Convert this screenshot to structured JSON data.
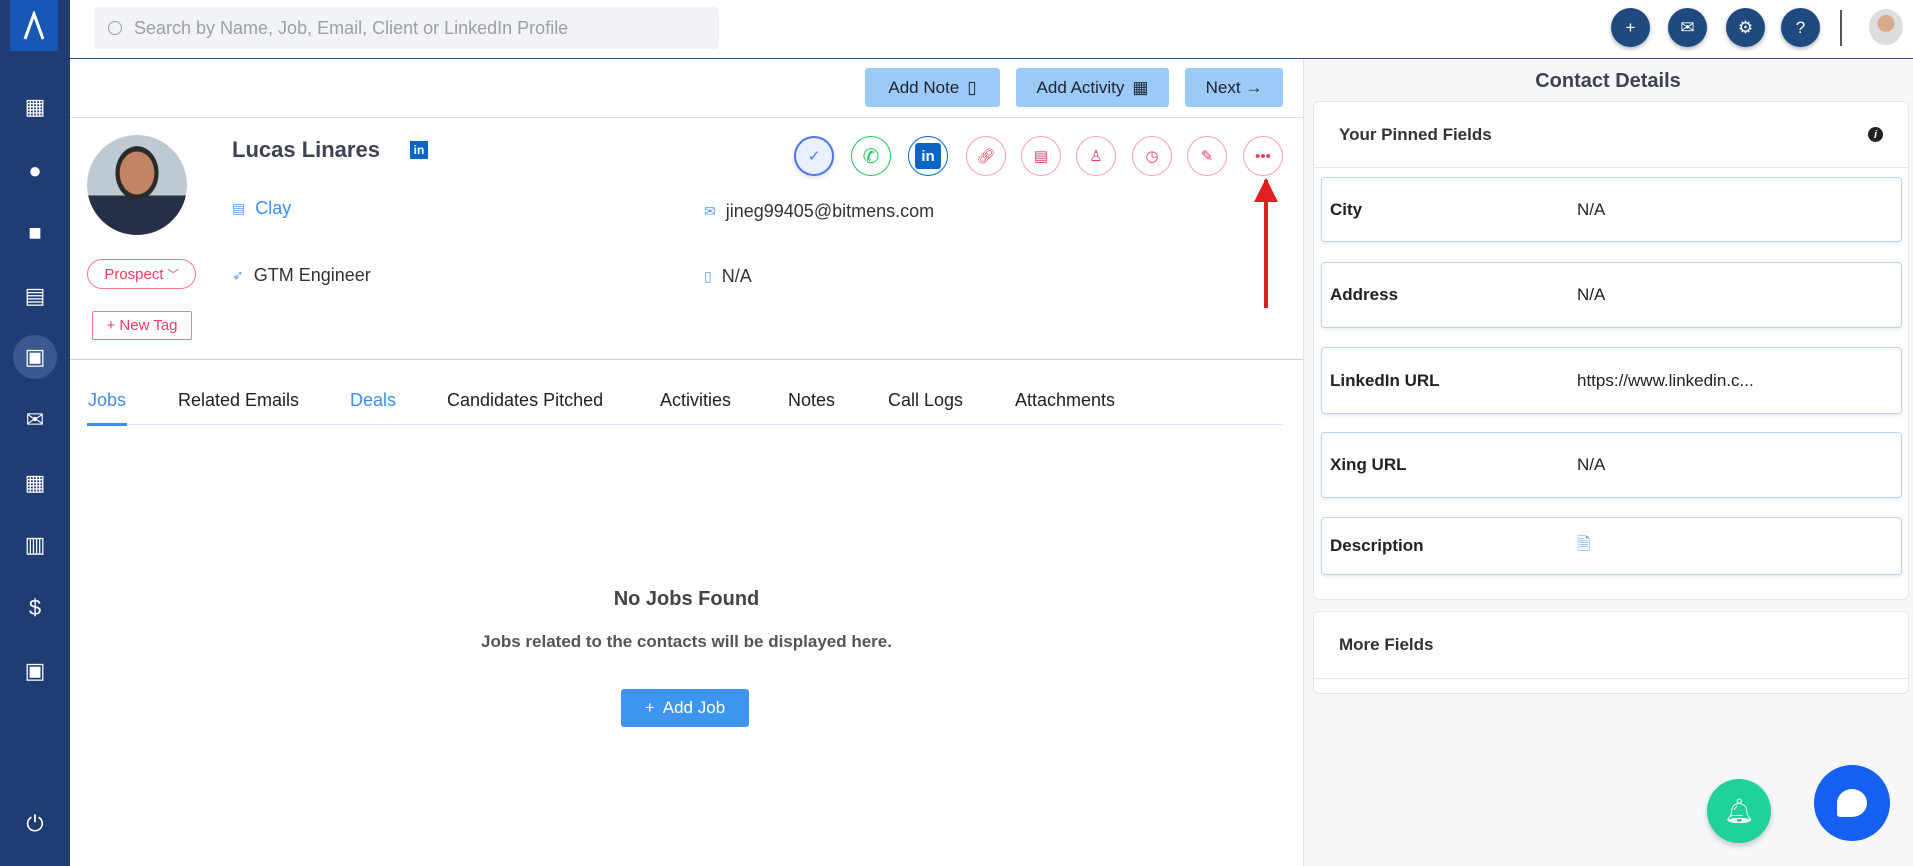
{
  "search": {
    "placeholder": "Search by Name, Job, Email, Client or LinkedIn Profile"
  },
  "toolbar": {
    "add_note": "Add Note",
    "add_activity": "Add Activity",
    "next": "Next →"
  },
  "contact": {
    "name": "Lucas Linares",
    "company": "Clay",
    "title": "GTM Engineer",
    "email": "jineg99405@bitmens.com",
    "phone": "N/A",
    "status": "Prospect",
    "new_tag": "+ New Tag"
  },
  "tabs": [
    "Jobs",
    "Related Emails",
    "Deals",
    "Candidates Pitched",
    "Activities",
    "Notes",
    "Call Logs",
    "Attachments"
  ],
  "empty": {
    "title": "No Jobs Found",
    "subtitle": "Jobs related to the contacts will be displayed here.",
    "button": "Add Job"
  },
  "details": {
    "title": "Contact Details",
    "pinned_header": "Your Pinned Fields",
    "more_header": "More Fields",
    "fields": [
      {
        "label": "City",
        "value": "N/A"
      },
      {
        "label": "Address",
        "value": "N/A"
      },
      {
        "label": "LinkedIn URL",
        "value": "https://www.linkedin.c..."
      },
      {
        "label": "Xing URL",
        "value": "N/A"
      },
      {
        "label": "Description",
        "value": ""
      }
    ]
  },
  "colors": {
    "sidebar": "#1f3d72",
    "accent": "#3d95f0",
    "pink": "#e5405e"
  }
}
